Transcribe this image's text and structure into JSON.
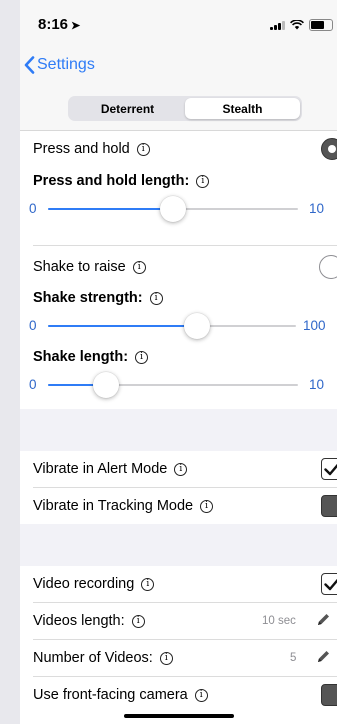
{
  "status": {
    "time": "8:16",
    "location_arrow": "➤"
  },
  "nav": {
    "back_label": "Settings"
  },
  "segments": [
    "Deterrent",
    "Stealth"
  ],
  "segment_selected": "Stealth",
  "press_hold": {
    "label": "Press and hold",
    "enabled": true,
    "length_label": "Press and hold length:",
    "slider": {
      "min": "0",
      "max": "10",
      "value": 5
    }
  },
  "shake": {
    "label": "Shake to raise",
    "enabled": false,
    "strength_label": "Shake strength:",
    "strength_slider": {
      "min": "0",
      "max": "100",
      "value": 60
    },
    "length_label": "Shake length:",
    "length_slider": {
      "min": "0",
      "max": "10",
      "value": 2.3
    }
  },
  "vibrate": {
    "alert_label": "Vibrate in Alert Mode",
    "alert_checked": true,
    "tracking_label": "Vibrate in Tracking Mode",
    "tracking_checked": false
  },
  "video": {
    "recording_label": "Video recording",
    "recording_checked": true,
    "length_label": "Videos length:",
    "length_value": "10 sec",
    "count_label": "Number of Videos:",
    "count_value": "5",
    "front_camera_label": "Use front-facing camera",
    "front_camera_checked": false
  },
  "colors": {
    "accent": "#2f7cf6",
    "background": "#f2f2f7"
  },
  "info_glyph": "i"
}
